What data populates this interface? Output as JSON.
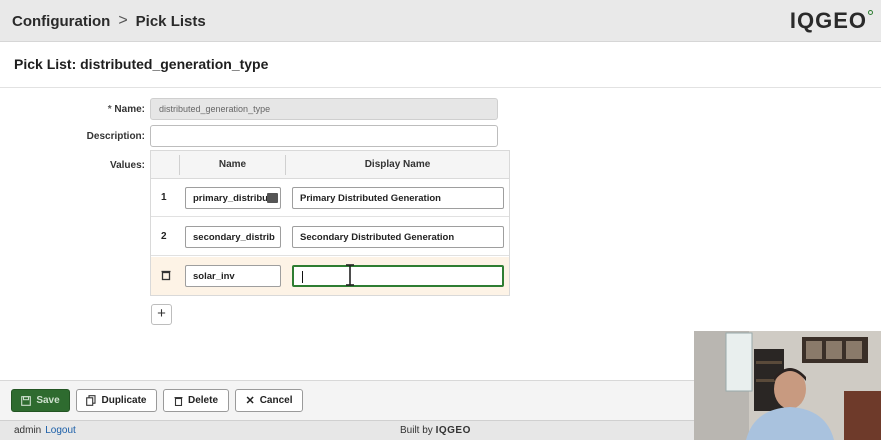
{
  "header": {
    "breadcrumb": [
      "Configuration",
      "Pick Lists"
    ],
    "breadcrumb_separator": ">",
    "logo_text": "IQGEO"
  },
  "page": {
    "title": "Pick List: distributed_generation_type"
  },
  "form": {
    "name_required_marker": "*",
    "name_label": "Name:",
    "name_value": "distributed_generation_type",
    "description_label": "Description:",
    "description_value": "",
    "values_label": "Values:"
  },
  "values_table": {
    "columns": [
      "Name",
      "Display Name"
    ],
    "rows": [
      {
        "index": "1",
        "name": "primary_distribut",
        "display_name": "Primary Distributed Generation"
      },
      {
        "index": "2",
        "name": "secondary_distrib",
        "display_name": "Secondary Distributed Generation"
      },
      {
        "index": "",
        "name": "solar_inv",
        "display_name": ""
      }
    ],
    "add_label": "+"
  },
  "footer": {
    "save": "Save",
    "duplicate": "Duplicate",
    "delete": "Delete",
    "cancel": "Cancel"
  },
  "status": {
    "user": "admin",
    "logout": "Logout",
    "built_by": "Built by",
    "built_brand": "IQGEO"
  },
  "colors": {
    "accent_green": "#2e6b2f",
    "focus_green": "#2e7d32"
  }
}
